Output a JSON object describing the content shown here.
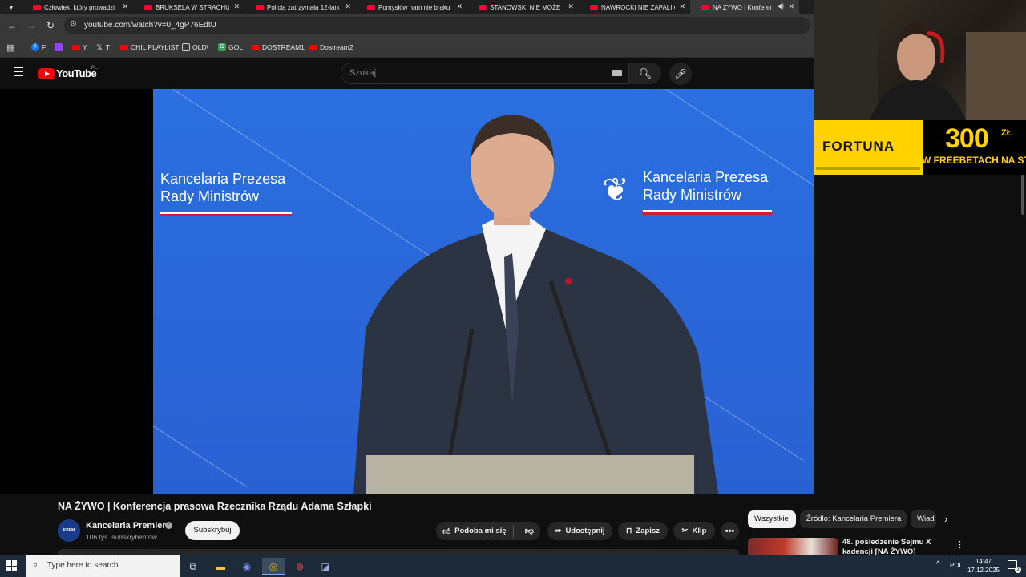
{
  "browser": {
    "tabs": [
      {
        "title": "Człowiek, który prowadzi"
      },
      {
        "title": "BRUKSELA W STRACHU. W"
      },
      {
        "title": "Policja zatrzymała 12-latk"
      },
      {
        "title": "Pomysłów nam nie braku"
      },
      {
        "title": "STANOWSKI NIE MOŻE U"
      },
      {
        "title": "NAWROCKI NIE ZAPALI C"
      },
      {
        "title": "NA ŻYWO | Konferen"
      }
    ],
    "url": "youtube.com/watch?v=0_4gP76EdtU",
    "bookmarks": [
      {
        "label": "F",
        "icon": "facebook-icon",
        "color": "#1877f2"
      },
      {
        "label": "",
        "icon": "twitch-icon",
        "color": "#9146ff"
      },
      {
        "label": "Y",
        "icon": "youtube-icon",
        "color": "#ff0000"
      },
      {
        "label": "T",
        "icon": "x-icon",
        "color": "#000000"
      },
      {
        "label": "CHIL PLAYLIST",
        "icon": "youtube-icon",
        "color": "#ff0000"
      },
      {
        "label": "OLD\\",
        "icon": "folder-icon",
        "color": "#383838"
      },
      {
        "label": "GOL",
        "icon": "gol-icon",
        "color": "#3a9d5d"
      },
      {
        "label": "DOSTREAM1",
        "icon": "youtube-icon",
        "color": "#ff0000"
      },
      {
        "label": "Dostream2",
        "icon": "youtube-icon",
        "color": "#ff0000"
      }
    ]
  },
  "youtube": {
    "logo_text": "YouTube",
    "region": "PL",
    "search_placeholder": "Szukaj"
  },
  "video_overlay": {
    "brand_left": [
      "Kancelaria Prezesa",
      "Rady Ministrów"
    ],
    "brand_right": [
      "Kancelaria Prezesa",
      "Rady Ministrów"
    ]
  },
  "video": {
    "title": "NA ŻYWO | Konferencja prasowa Rzecznika Rządu Adama Szłapki",
    "channel_name": "Kancelaria Premiera",
    "channel_avatar_text": "KPRM",
    "subscribers": "106 tys. subskrybentów",
    "subscribe_label": "Subskrybuj",
    "like_label": "Podoba mi się",
    "share_label": "Udostępnij",
    "save_label": "Zapisz",
    "clip_label": "Klip"
  },
  "related": {
    "chips": [
      "Wszystkie",
      "Źródło: Kancelaria Premiera",
      "Wiad"
    ],
    "first_item_title": "48. posiedzenie Sejmu X kadencji [NA ŻYWO]"
  },
  "ad": {
    "brand": "FORTUNA",
    "amount": "300",
    "currency": "ZŁ",
    "slogan": "W FREEBETACH NA START"
  },
  "taskbar": {
    "search_placeholder": "Type here to search",
    "language": "POL",
    "time": "14:47",
    "date": "17.12.2025",
    "notifications": "3"
  },
  "colors": {
    "youtube_red": "#ff0000",
    "video_blue": "#2b6fe0",
    "fortuna_yellow": "#ffd200",
    "taskbar": "#1c2a3a"
  }
}
